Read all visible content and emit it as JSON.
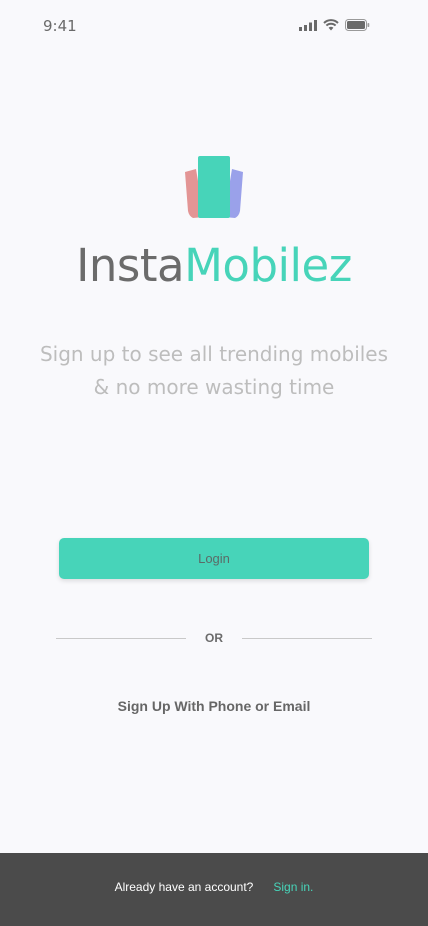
{
  "status_bar": {
    "time": "9:41",
    "icons": [
      "signal-icon",
      "wifi-icon",
      "battery-icon"
    ]
  },
  "brand": {
    "name_part1": "Insta",
    "name_part2": "Mobilez",
    "logo_icon": "phones-stack-icon"
  },
  "tagline": {
    "line1": "Sign up to see all trending mobiles",
    "line2": "& no more wasting time"
  },
  "actions": {
    "login_label": "Login",
    "divider_text": "OR",
    "signup_label": "Sign Up With Phone or Email"
  },
  "footer": {
    "prompt": "Already have an account?",
    "link": "Sign in."
  },
  "colors": {
    "accent": "#47d4b9",
    "background": "#f9f9fc",
    "footer_bg": "#4b4b4b",
    "brand_gray": "#6b6b6b",
    "logo_red": "#e08a8a",
    "logo_blue": "#8f97e8"
  }
}
